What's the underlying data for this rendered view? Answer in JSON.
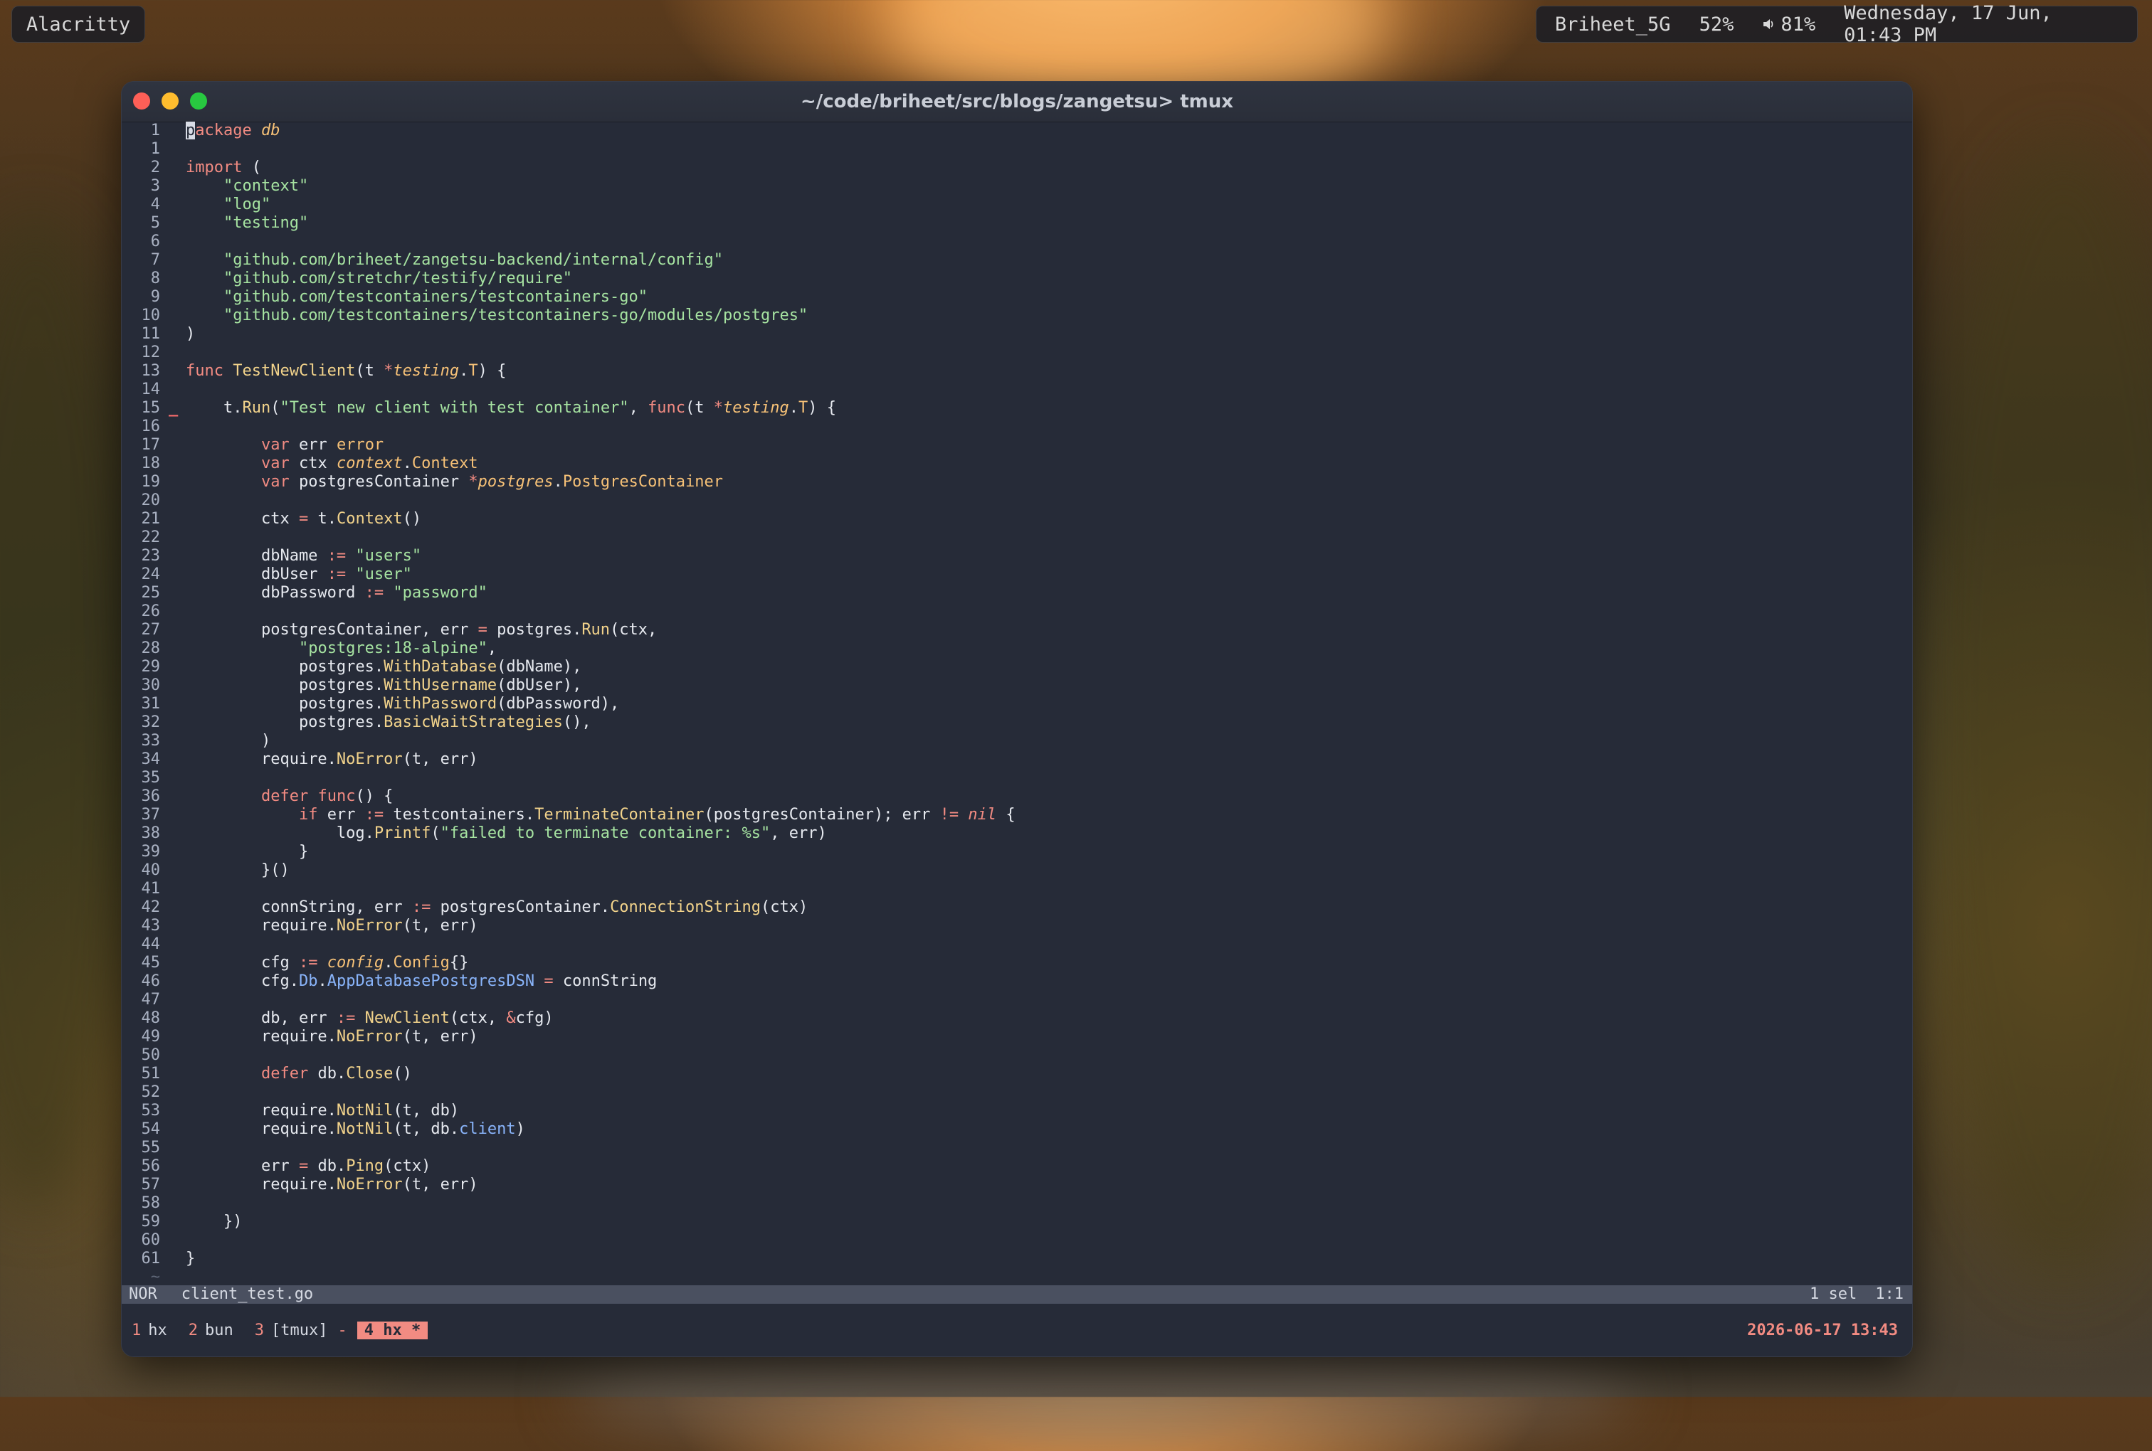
{
  "topbar": {
    "app_name": "Alacritty",
    "network": "Briheet_5G",
    "battery": "52%",
    "volume": "81%",
    "datetime": "Wednesday, 17 Jun, 01:43 PM"
  },
  "window": {
    "title": "~/code/briheet/src/blogs/zangetsu> tmux"
  },
  "editor": {
    "lines": [
      {
        "n": "1",
        "html": "<span class='cursor'>p</span><span class='k'>ackage</span> <span class='pk'>db</span>"
      },
      {
        "n": "1",
        "html": ""
      },
      {
        "n": "2",
        "html": "<span class='k'>import</span> ("
      },
      {
        "n": "3",
        "html": "    <span class='s'>\"context\"</span>"
      },
      {
        "n": "4",
        "html": "    <span class='s'>\"log\"</span>"
      },
      {
        "n": "5",
        "html": "    <span class='s'>\"testing\"</span>"
      },
      {
        "n": "6",
        "html": ""
      },
      {
        "n": "7",
        "html": "    <span class='s'>\"github.com/briheet/zangetsu-backend/internal/config\"</span>"
      },
      {
        "n": "8",
        "html": "    <span class='s'>\"github.com/stretchr/testify/require\"</span>"
      },
      {
        "n": "9",
        "html": "    <span class='s'>\"github.com/testcontainers/testcontainers-go\"</span>"
      },
      {
        "n": "10",
        "html": "    <span class='s'>\"github.com/testcontainers/testcontainers-go/modules/postgres\"</span>"
      },
      {
        "n": "11",
        "html": ")"
      },
      {
        "n": "12",
        "html": ""
      },
      {
        "n": "13",
        "html": "<span class='k'>func</span> <span class='f'>TestNewClient</span>(t <span class='o'>*</span><span class='pk'>testing</span>.<span class='t' style='font-style:normal'>T</span>) {"
      },
      {
        "n": "14",
        "html": ""
      },
      {
        "n": "15",
        "html": "    t.<span class='f'>Run</span>(<span class='s'>\"Test new client with test container\"</span>, <span class='k'>func</span>(t <span class='o'>*</span><span class='pk'>testing</span>.<span class='t' style='font-style:normal'>T</span>) {",
        "gut": "_"
      },
      {
        "n": "16",
        "html": ""
      },
      {
        "n": "17",
        "html": "        <span class='k'>var</span> err <span class='t' style='font-style:normal'>error</span>"
      },
      {
        "n": "18",
        "html": "        <span class='k'>var</span> ctx <span class='pk'>context</span>.<span class='t' style='font-style:normal'>Context</span>"
      },
      {
        "n": "19",
        "html": "        <span class='k'>var</span> postgresContainer <span class='o'>*</span><span class='pk'>postgres</span>.<span class='t' style='font-style:normal'>PostgresContainer</span>"
      },
      {
        "n": "20",
        "html": ""
      },
      {
        "n": "21",
        "html": "        ctx <span class='o'>=</span> t.<span class='f'>Context</span>()"
      },
      {
        "n": "22",
        "html": ""
      },
      {
        "n": "23",
        "html": "        dbName <span class='o'>:=</span> <span class='s'>\"users\"</span>"
      },
      {
        "n": "24",
        "html": "        dbUser <span class='o'>:=</span> <span class='s'>\"user\"</span>"
      },
      {
        "n": "25",
        "html": "        dbPassword <span class='o'>:=</span> <span class='s'>\"password\"</span>"
      },
      {
        "n": "26",
        "html": ""
      },
      {
        "n": "27",
        "html": "        postgresContainer, err <span class='o'>=</span> postgres.<span class='f'>Run</span>(ctx,"
      },
      {
        "n": "28",
        "html": "            <span class='s'>\"postgres:18-alpine\"</span>,"
      },
      {
        "n": "29",
        "html": "            postgres.<span class='f'>WithDatabase</span>(dbName),"
      },
      {
        "n": "30",
        "html": "            postgres.<span class='f'>WithUsername</span>(dbUser),"
      },
      {
        "n": "31",
        "html": "            postgres.<span class='f'>WithPassword</span>(dbPassword),"
      },
      {
        "n": "32",
        "html": "            postgres.<span class='f'>BasicWaitStrategies</span>(),"
      },
      {
        "n": "33",
        "html": "        )"
      },
      {
        "n": "34",
        "html": "        require.<span class='f'>NoError</span>(t, err)"
      },
      {
        "n": "35",
        "html": ""
      },
      {
        "n": "36",
        "html": "        <span class='k'>defer</span> <span class='k'>func</span>() {"
      },
      {
        "n": "37",
        "html": "            <span class='k'>if</span> err <span class='o'>:=</span> testcontainers.<span class='f'>TerminateContainer</span>(postgresContainer); err <span class='o'>!=</span> <span class='k' style='font-style:italic'>nil</span> {"
      },
      {
        "n": "38",
        "html": "                log.<span class='f'>Printf</span>(<span class='s'>\"failed to terminate container: %s\"</span>, err)"
      },
      {
        "n": "39",
        "html": "            }"
      },
      {
        "n": "40",
        "html": "        }()"
      },
      {
        "n": "41",
        "html": ""
      },
      {
        "n": "42",
        "html": "        connString, err <span class='o'>:=</span> postgresContainer.<span class='f'>ConnectionString</span>(ctx)"
      },
      {
        "n": "43",
        "html": "        require.<span class='f'>NoError</span>(t, err)"
      },
      {
        "n": "44",
        "html": ""
      },
      {
        "n": "45",
        "html": "        cfg <span class='o'>:=</span> <span class='pk'>config</span>.<span class='t' style='font-style:normal'>Config</span>{}"
      },
      {
        "n": "46",
        "html": "        cfg.<span class='fd'>Db</span>.<span class='fd'>AppDatabasePostgresDSN</span> <span class='o'>=</span> connString"
      },
      {
        "n": "47",
        "html": ""
      },
      {
        "n": "48",
        "html": "        db, err <span class='o'>:=</span> <span class='f'>NewClient</span>(ctx, <span class='o'>&amp;</span>cfg)"
      },
      {
        "n": "49",
        "html": "        require.<span class='f'>NoError</span>(t, err)"
      },
      {
        "n": "50",
        "html": ""
      },
      {
        "n": "51",
        "html": "        <span class='k'>defer</span> db.<span class='f'>Close</span>()"
      },
      {
        "n": "52",
        "html": ""
      },
      {
        "n": "53",
        "html": "        require.<span class='f'>NotNil</span>(t, db)"
      },
      {
        "n": "54",
        "html": "        require.<span class='f'>NotNil</span>(t, db.<span class='fd'>client</span>)"
      },
      {
        "n": "55",
        "html": ""
      },
      {
        "n": "56",
        "html": "        err <span class='o'>=</span> db.<span class='f'>Ping</span>(ctx)"
      },
      {
        "n": "57",
        "html": "        require.<span class='f'>NoError</span>(t, err)"
      },
      {
        "n": "58",
        "html": ""
      },
      {
        "n": "59",
        "html": "    })"
      },
      {
        "n": "60",
        "html": ""
      },
      {
        "n": "61",
        "html": "}"
      }
    ],
    "end_marker": "~"
  },
  "statusline": {
    "mode": "NOR",
    "filename": "client_test.go",
    "selection": "1 sel",
    "position": "1:1"
  },
  "tmux": {
    "windows": [
      {
        "num": "1",
        "name": "hx"
      },
      {
        "num": "2",
        "name": "bun"
      },
      {
        "num": "3",
        "name": "[tmux]"
      }
    ],
    "separator": "-",
    "active_window": "4 hx *",
    "clock": "2026-06-17 13:43"
  },
  "colors": {
    "keyword": "#f28b82",
    "string": "#a6e3a1",
    "type": "#f6c177",
    "function": "#f2d38b",
    "field": "#89b4fa",
    "background": "#262b38"
  }
}
